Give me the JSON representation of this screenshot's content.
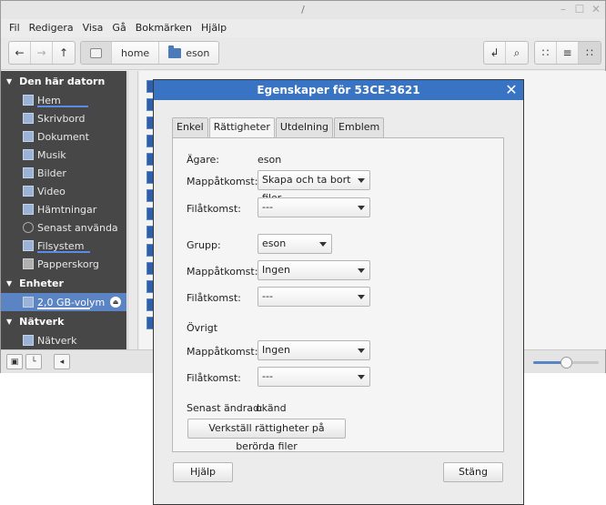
{
  "fm": {
    "title": "/",
    "menu": [
      "Fil",
      "Redigera",
      "Visa",
      "Gå",
      "Bokmärken",
      "Hjälp"
    ],
    "path": {
      "c1": "home",
      "c2": "eson"
    }
  },
  "sidebar": {
    "sec_computer": "Den här datorn",
    "computer_items": [
      "Hem",
      "Skrivbord",
      "Dokument",
      "Musik",
      "Bilder",
      "Video",
      "Hämtningar",
      "Senast använda",
      "Filsystem",
      "Papperskorg"
    ],
    "sec_devices": "Enheter",
    "device_item": "2,0 GB-volym",
    "sec_network": "Nätverk",
    "network_item": "Nätverk"
  },
  "dialog": {
    "title": "Egenskaper för 53CE-3621",
    "tabs": [
      "Enkel",
      "Rättigheter",
      "Utdelning",
      "Emblem"
    ],
    "owner_label": "Ägare:",
    "owner_value": "eson",
    "owner_folder_label": "Mappåtkomst:",
    "owner_folder_value": "Skapa och ta bort filer",
    "owner_file_label": "Filåtkomst:",
    "owner_file_value": "---",
    "group_label": "Grupp:",
    "group_value": "eson",
    "group_folder_label": "Mappåtkomst:",
    "group_folder_value": "Ingen",
    "group_file_label": "Filåtkomst:",
    "group_file_value": "---",
    "other_label": "Övrigt",
    "other_folder_label": "Mappåtkomst:",
    "other_folder_value": "Ingen",
    "other_file_label": "Filåtkomst:",
    "other_file_value": "---",
    "modified_label": "Senast ändrad:",
    "modified_value": "okänd",
    "apply_button": "Verkställ rättigheter på berörda filer",
    "help_button": "Hjälp",
    "close_button": "Stäng"
  },
  "status": {
    "zoom_level": 0.5
  },
  "colors": {
    "accent": "#3873c4",
    "sidebar_bg": "#474747",
    "selection": "#5a84c4"
  }
}
